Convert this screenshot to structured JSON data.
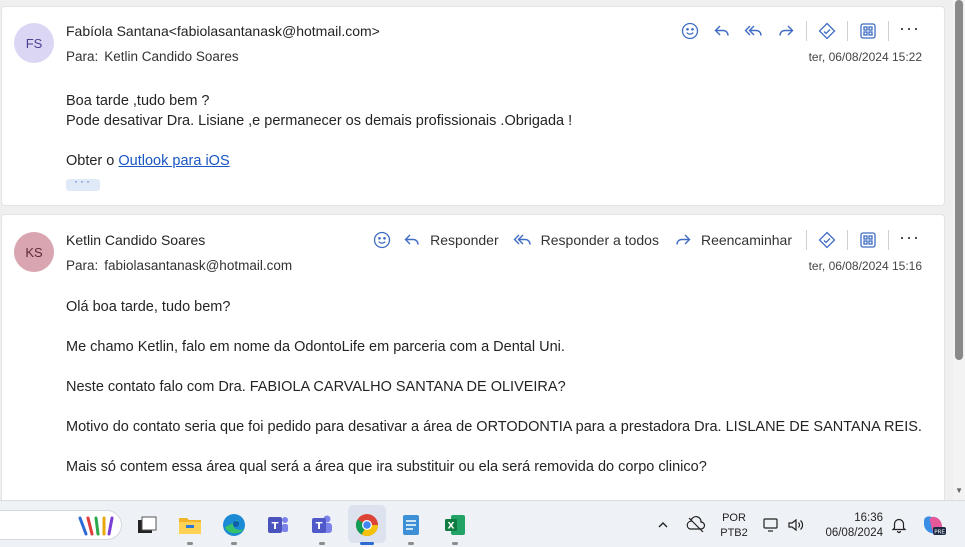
{
  "messages": [
    {
      "initials": "FS",
      "from": "Fabíola Santana<fabiolasantanask@hotmail.com>",
      "to_label": "Para:",
      "to": "Ketlin Candido Soares",
      "date": "ter, 06/08/2024 15:22",
      "body": [
        "Boa tarde ,tudo bem ?",
        "Pode desativar Dra. Lisiane ,e permanecer os demais profissionais .Obrigada !"
      ],
      "footer_prefix": "Obter o ",
      "footer_link": "Outlook para iOS",
      "expand_label": "···"
    },
    {
      "initials": "KS",
      "from": "Ketlin Candido Soares",
      "to_label": "Para:",
      "to": "fabiolasantanask@hotmail.com",
      "date": "ter, 06/08/2024 15:16",
      "actions": {
        "reply": "Responder",
        "reply_all": "Responder a todos",
        "forward": "Reencaminhar"
      },
      "body": [
        "Olá boa tarde, tudo bem?",
        "Me chamo Ketlin, falo em nome da OdontoLife em parceria com a Dental Uni.",
        "Neste contato falo com Dra. FABIOLA CARVALHO SANTANA DE OLIVEIRA?",
        "Motivo do contato seria que foi pedido para desativar a área de ORTODONTIA para a prestadora Dra. LISLANE DE SANTANA REIS.",
        "Mais só contem essa área qual será a área que ira substituir ou ela será removida do corpo clinico?"
      ]
    }
  ],
  "more_label": "···",
  "taskbar": {
    "apps": [
      "file-explorer-icon",
      "edge-icon",
      "teams-icon",
      "teams-2-icon",
      "chrome-icon",
      "notepad-icon",
      "excel-icon"
    ],
    "tray_chevron": "^",
    "lang_top": "POR",
    "lang_bottom": "PTB2",
    "time": "16:36",
    "date": "06/08/2024",
    "copilot_badge": "PRE"
  },
  "colors": {
    "accent": "#3f6cc4",
    "link": "#1a56c4"
  }
}
